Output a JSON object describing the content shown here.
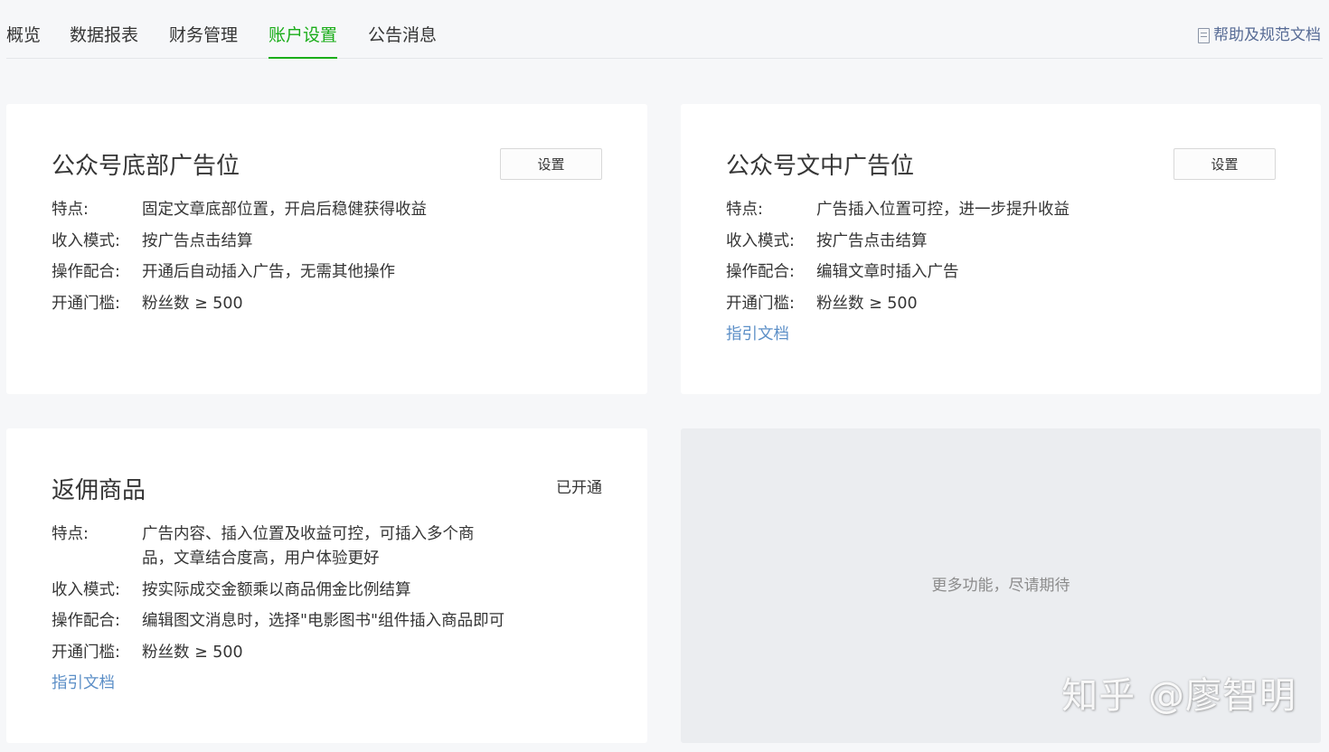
{
  "nav": {
    "tabs": [
      {
        "label": "概览"
      },
      {
        "label": "数据报表"
      },
      {
        "label": "财务管理"
      },
      {
        "label": "账户设置"
      },
      {
        "label": "公告消息"
      }
    ],
    "active_tab": "账户设置",
    "help_link": "帮助及规范文档"
  },
  "cards": {
    "bottom_ad": {
      "title": "公众号底部广告位",
      "button": "设置",
      "features": [
        {
          "label": "特点:",
          "value": "固定文章底部位置，开启后稳健获得收益"
        },
        {
          "label": "收入模式:",
          "value": "按广告点击结算"
        },
        {
          "label": "操作配合:",
          "value": "开通后自动插入广告，无需其他操作"
        },
        {
          "label": "开通门槛:",
          "value": "粉丝数 ≥ 500"
        }
      ]
    },
    "inline_ad": {
      "title": "公众号文中广告位",
      "button": "设置",
      "features": [
        {
          "label": "特点:",
          "value": "广告插入位置可控，进一步提升收益"
        },
        {
          "label": "收入模式:",
          "value": "按广告点击结算"
        },
        {
          "label": "操作配合:",
          "value": "编辑文章时插入广告"
        },
        {
          "label": "开通门槛:",
          "value": "粉丝数 ≥ 500"
        }
      ],
      "guide_link": "指引文档"
    },
    "commission": {
      "title": "返佣商品",
      "status": "已开通",
      "features": [
        {
          "label": "特点:",
          "value": "广告内容、插入位置及收益可控，可插入多个商品，文章结合度高，用户体验更好"
        },
        {
          "label": "收入模式:",
          "value": "按实际成交金额乘以商品佣金比例结算"
        },
        {
          "label": "操作配合:",
          "value": "编辑图文消息时，选择\"电影图书\"组件插入商品即可"
        },
        {
          "label": "开通门槛:",
          "value": "粉丝数 ≥ 500"
        }
      ],
      "guide_link": "指引文档"
    }
  },
  "placeholder": {
    "text": "更多功能，尽请期待"
  },
  "watermark": "知乎 @廖智明",
  "colors": {
    "accent": "#1aad19",
    "link": "#5c8fc7",
    "background": "#f6f7f9",
    "placeholder_bg": "#ebedf0"
  }
}
